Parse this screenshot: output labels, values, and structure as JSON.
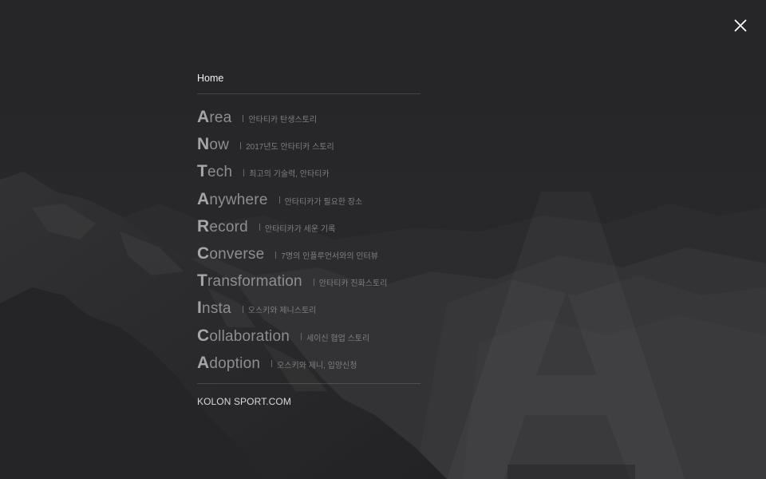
{
  "close": {
    "icon": "close-icon"
  },
  "nav": {
    "home": "Home",
    "items": [
      {
        "first": "A",
        "rest": "rea",
        "sub": "안타티카 탄생스토리"
      },
      {
        "first": "N",
        "rest": "ow",
        "sub": "2017년도 안타티카 스토리"
      },
      {
        "first": "T",
        "rest": "ech",
        "sub": "최고의 기술력, 안타티카"
      },
      {
        "first": "A",
        "rest": "nywhere",
        "sub": "안타티카가 필요한 장소"
      },
      {
        "first": "R",
        "rest": "ecord",
        "sub": "안타티카가 세운 기록"
      },
      {
        "first": "C",
        "rest": "onverse",
        "sub": "7명의 인플루언서와의 인터뷰"
      },
      {
        "first": "T",
        "rest": "ransformation",
        "sub": "안타티카 진화스토리"
      },
      {
        "first": "I",
        "rest": "nsta",
        "sub": "오스키와 제니스토리"
      },
      {
        "first": "C",
        "rest": "ollaboration",
        "sub": "세이신 협업 스토리"
      },
      {
        "first": "A",
        "rest": "doption",
        "sub": "오스키와 제니, 입양신청"
      }
    ],
    "footer": "KOLON SPORT.COM"
  },
  "background": {
    "watermark_letter": "A",
    "base_color": "#2a2a2c"
  }
}
